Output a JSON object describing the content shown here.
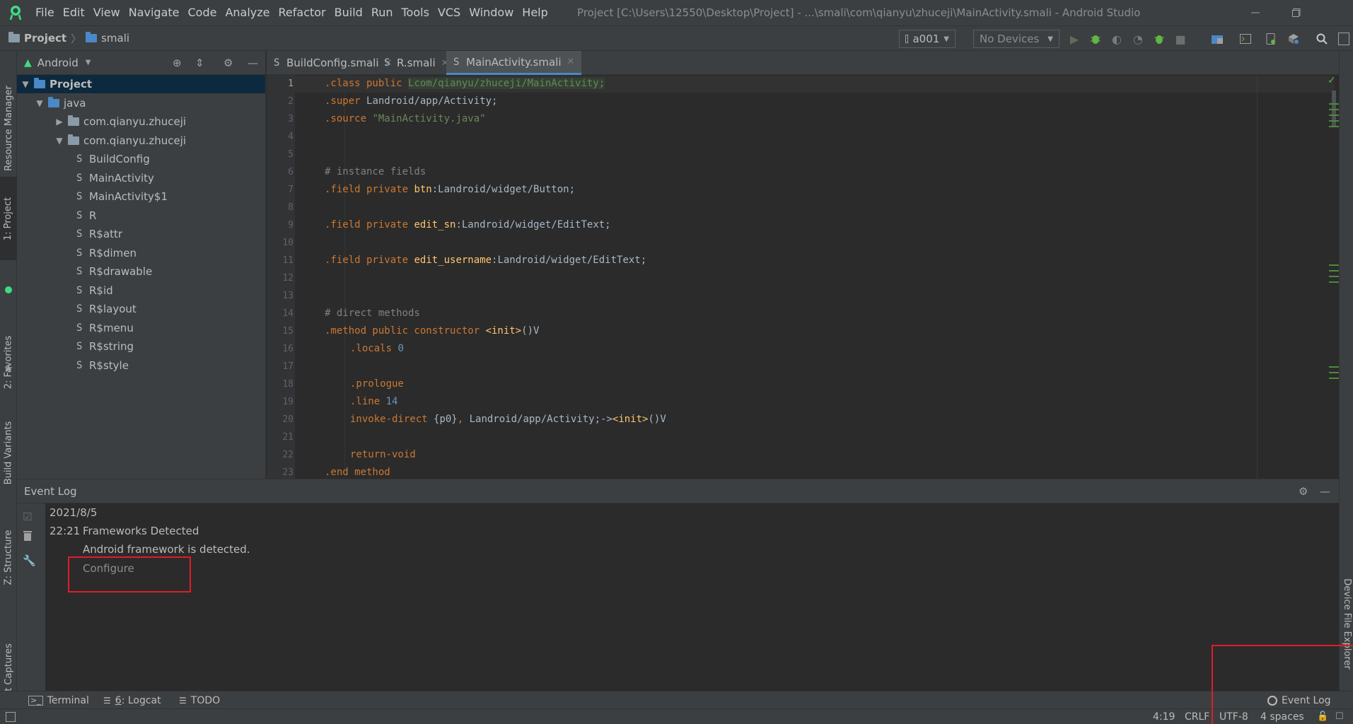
{
  "app": {
    "window_title": "Project [C:\\Users\\12550\\Desktop\\Project] - ...\\smali\\com\\qianyu\\zhuceji\\MainActivity.smali - Android Studio",
    "menu": [
      "File",
      "Edit",
      "View",
      "Navigate",
      "Code",
      "Analyze",
      "Refactor",
      "Build",
      "Run",
      "Tools",
      "VCS",
      "Window",
      "Help"
    ]
  },
  "breadcrumb": [
    "Project",
    "smali"
  ],
  "toolbar": {
    "run_config": "a001",
    "device": "No Devices"
  },
  "left_strip": {
    "resource_manager": "Resource Manager",
    "project": "1: Project",
    "favorites": "2: Favorites",
    "build_variants": "Build Variants",
    "structure": "Z: Structure",
    "layout_captures": "Layout Captures"
  },
  "right_strip": {
    "device_file_explorer": "Device File Explorer"
  },
  "project_panel": {
    "view_mode": "Android",
    "tree": [
      {
        "label": "Project",
        "level": 0,
        "kind": "folder",
        "expanded": true,
        "selected": true
      },
      {
        "label": "java",
        "level": 1,
        "kind": "folder",
        "expanded": true
      },
      {
        "label": "com.qianyu.zhuceji",
        "level": 2,
        "kind": "package",
        "expanded": false
      },
      {
        "label": "com.qianyu.zhuceji",
        "level": 2,
        "kind": "package",
        "expanded": true
      },
      {
        "label": "BuildConfig",
        "level": 3,
        "kind": "smali"
      },
      {
        "label": "MainActivity",
        "level": 3,
        "kind": "smali"
      },
      {
        "label": "MainActivity$1",
        "level": 3,
        "kind": "smali"
      },
      {
        "label": "R",
        "level": 3,
        "kind": "smali"
      },
      {
        "label": "R$attr",
        "level": 3,
        "kind": "smali"
      },
      {
        "label": "R$dimen",
        "level": 3,
        "kind": "smali"
      },
      {
        "label": "R$drawable",
        "level": 3,
        "kind": "smali"
      },
      {
        "label": "R$id",
        "level": 3,
        "kind": "smali"
      },
      {
        "label": "R$layout",
        "level": 3,
        "kind": "smali"
      },
      {
        "label": "R$menu",
        "level": 3,
        "kind": "smali"
      },
      {
        "label": "R$string",
        "level": 3,
        "kind": "smali"
      },
      {
        "label": "R$style",
        "level": 3,
        "kind": "smali"
      }
    ]
  },
  "editor": {
    "tabs": [
      {
        "label": "BuildConfig.smali",
        "active": false
      },
      {
        "label": "R.smali",
        "active": false
      },
      {
        "label": "MainActivity.smali",
        "active": true
      }
    ],
    "current_line": 1,
    "lines": [
      {
        "n": "1",
        "indent": false,
        "tokens": [
          {
            "t": ".class public ",
            "c": "kw"
          },
          {
            "t": "Lcom/qianyu/zhuceji/MainActivity;",
            "c": "hl"
          }
        ]
      },
      {
        "n": "2",
        "indent": false,
        "tokens": [
          {
            "t": ".super ",
            "c": "kw"
          },
          {
            "t": "Landroid/app/Activity;",
            "c": "id"
          }
        ]
      },
      {
        "n": "3",
        "indent": false,
        "tokens": [
          {
            "t": ".source ",
            "c": "kw"
          },
          {
            "t": "\"MainActivity.java\"",
            "c": "str"
          }
        ]
      },
      {
        "n": "4",
        "indent": false,
        "tokens": []
      },
      {
        "n": "5",
        "indent": false,
        "tokens": []
      },
      {
        "n": "6",
        "indent": false,
        "tokens": [
          {
            "t": "# instance fields",
            "c": "cm"
          }
        ]
      },
      {
        "n": "7",
        "indent": false,
        "tokens": [
          {
            "t": ".field private ",
            "c": "kw"
          },
          {
            "t": "btn",
            "c": "nm"
          },
          {
            "t": ":Landroid/widget/Button;",
            "c": "id"
          }
        ]
      },
      {
        "n": "8",
        "indent": false,
        "tokens": []
      },
      {
        "n": "9",
        "indent": false,
        "tokens": [
          {
            "t": ".field private ",
            "c": "kw"
          },
          {
            "t": "edit_sn",
            "c": "nm"
          },
          {
            "t": ":Landroid/widget/EditText;",
            "c": "id"
          }
        ]
      },
      {
        "n": "10",
        "indent": false,
        "tokens": []
      },
      {
        "n": "11",
        "indent": false,
        "tokens": [
          {
            "t": ".field private ",
            "c": "kw"
          },
          {
            "t": "edit_username",
            "c": "nm"
          },
          {
            "t": ":Landroid/widget/EditText;",
            "c": "id"
          }
        ]
      },
      {
        "n": "12",
        "indent": false,
        "tokens": []
      },
      {
        "n": "13",
        "indent": false,
        "tokens": []
      },
      {
        "n": "14",
        "indent": false,
        "tokens": [
          {
            "t": "# direct methods",
            "c": "cm"
          }
        ]
      },
      {
        "n": "15",
        "indent": false,
        "tokens": [
          {
            "t": ".method public constructor ",
            "c": "kw"
          },
          {
            "t": "<init>",
            "c": "nm"
          },
          {
            "t": "()V",
            "c": "id"
          }
        ]
      },
      {
        "n": "16",
        "indent": true,
        "tokens": [
          {
            "t": ".locals ",
            "c": "kw"
          },
          {
            "t": "0",
            "c": "num"
          }
        ]
      },
      {
        "n": "17",
        "indent": false,
        "tokens": []
      },
      {
        "n": "18",
        "indent": true,
        "tokens": [
          {
            "t": ".prologue",
            "c": "kw"
          }
        ]
      },
      {
        "n": "19",
        "indent": true,
        "tokens": [
          {
            "t": ".line ",
            "c": "kw"
          },
          {
            "t": "14",
            "c": "num"
          }
        ]
      },
      {
        "n": "20",
        "indent": true,
        "tokens": [
          {
            "t": "invoke-direct ",
            "c": "kw"
          },
          {
            "t": "{p0}",
            "c": "id"
          },
          {
            "t": ", ",
            "c": "kw"
          },
          {
            "t": "Landroid/app/Activity;->",
            "c": "id"
          },
          {
            "t": "<init>",
            "c": "nm"
          },
          {
            "t": "()V",
            "c": "id"
          }
        ]
      },
      {
        "n": "21",
        "indent": false,
        "tokens": []
      },
      {
        "n": "22",
        "indent": true,
        "tokens": [
          {
            "t": "return-void",
            "c": "kw"
          }
        ]
      },
      {
        "n": "23",
        "indent": false,
        "tokens": [
          {
            "t": ".end method",
            "c": "kw"
          }
        ]
      }
    ]
  },
  "event_log": {
    "title": "Event Log",
    "date": "2021/8/5",
    "time": "22:21",
    "entry_title": "Frameworks Detected",
    "entry_message": "Android framework is detected.",
    "action_link": "Configure"
  },
  "bottom_tools": {
    "terminal": "Terminal",
    "logcat_num": "6",
    "logcat_rest": ": Logcat",
    "todo": "TODO",
    "event_log": "Event Log"
  },
  "status": {
    "position": "4:19",
    "line_sep": "CRLF",
    "encoding": "UTF-8",
    "indent": "4 spaces"
  },
  "colors": {
    "accent": "#4a88c7",
    "highlight_red": "#e21b2a",
    "android_green": "#3ddc84"
  }
}
